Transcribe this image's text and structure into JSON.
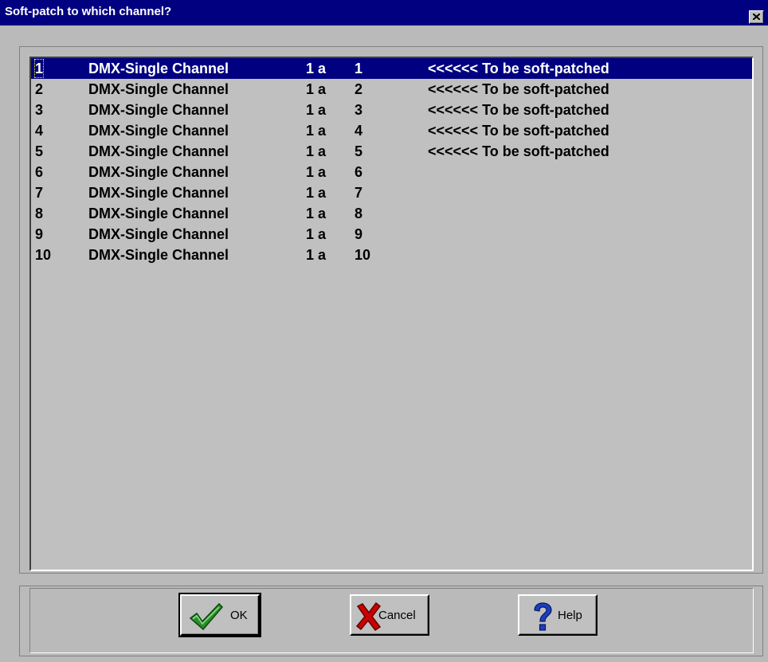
{
  "window": {
    "title": "Soft-patch to which channel?"
  },
  "list": {
    "rows": [
      {
        "num": "1",
        "type": "DMX-Single Channel",
        "universe": "1 a",
        "channel": "1",
        "note": "<<<<<< To be soft-patched",
        "selected": true
      },
      {
        "num": "2",
        "type": "DMX-Single Channel",
        "universe": "1 a",
        "channel": "2",
        "note": "<<<<<< To be soft-patched",
        "selected": false
      },
      {
        "num": "3",
        "type": "DMX-Single Channel",
        "universe": "1 a",
        "channel": "3",
        "note": "<<<<<< To be soft-patched",
        "selected": false
      },
      {
        "num": "4",
        "type": "DMX-Single Channel",
        "universe": "1 a",
        "channel": "4",
        "note": "<<<<<< To be soft-patched",
        "selected": false
      },
      {
        "num": "5",
        "type": "DMX-Single Channel",
        "universe": "1 a",
        "channel": "5",
        "note": "<<<<<< To be soft-patched",
        "selected": false
      },
      {
        "num": "6",
        "type": "DMX-Single Channel",
        "universe": "1 a",
        "channel": "6",
        "note": "",
        "selected": false
      },
      {
        "num": "7",
        "type": "DMX-Single Channel",
        "universe": "1 a",
        "channel": "7",
        "note": "",
        "selected": false
      },
      {
        "num": "8",
        "type": "DMX-Single Channel",
        "universe": "1 a",
        "channel": "8",
        "note": "",
        "selected": false
      },
      {
        "num": "9",
        "type": "DMX-Single Channel",
        "universe": "1 a",
        "channel": "9",
        "note": "",
        "selected": false
      },
      {
        "num": "10",
        "type": "DMX-Single Channel",
        "universe": "1 a",
        "channel": "10",
        "note": "",
        "selected": false
      }
    ]
  },
  "buttons": {
    "ok": {
      "label": "OK",
      "icon": "checkmark-icon"
    },
    "cancel": {
      "label": "Cancel",
      "icon": "red-x-icon"
    },
    "help": {
      "label": "Help",
      "icon": "question-mark-icon"
    }
  },
  "colors": {
    "titlebar": "#000080",
    "selection": "#000080",
    "face": "#c0c0c0",
    "ok_check": "#2e8b2e",
    "cancel_x": "#cc0000",
    "help_q": "#1a3fbf"
  }
}
